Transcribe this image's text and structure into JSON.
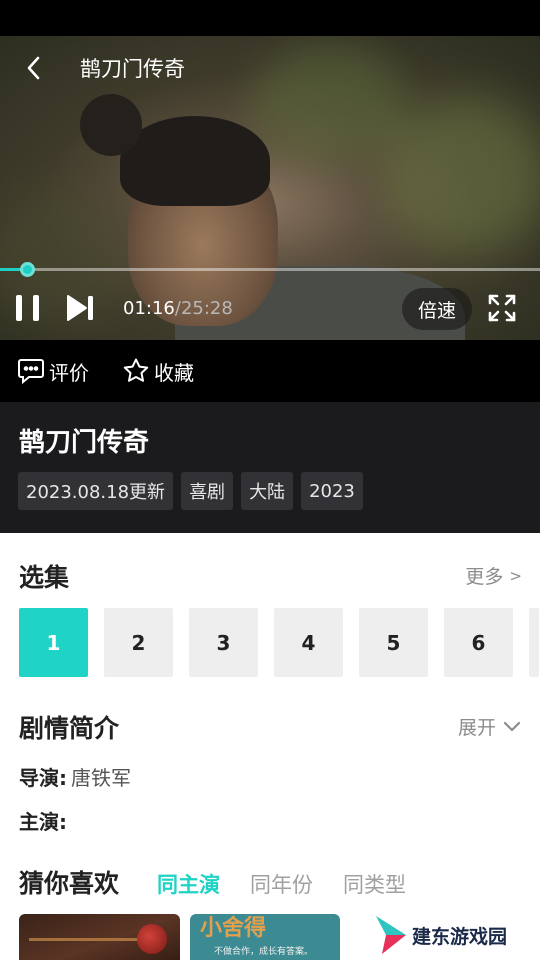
{
  "player": {
    "title": "鹊刀门传奇",
    "current_time": "01:16",
    "separator": "/",
    "total_time": "25:28",
    "progress": 0.05,
    "speed_label": "倍速",
    "accent": "#1fcfc3"
  },
  "actions": {
    "review_label": "评价",
    "favorite_label": "收藏"
  },
  "show": {
    "title": "鹊刀门传奇",
    "tags": [
      "2023.08.18更新",
      "喜剧",
      "大陆",
      "2023"
    ]
  },
  "episodes": {
    "title": "选集",
    "more_label": "更多",
    "more_arrow": ">",
    "items": [
      "1",
      "2",
      "3",
      "4",
      "5",
      "6"
    ],
    "selected": "1"
  },
  "synopsis": {
    "title": "剧情简介",
    "expand_label": "展开",
    "director_label": "导演:",
    "director": "唐铁军",
    "cast_label": "主演:",
    "cast": ""
  },
  "recommend": {
    "title": "猜你喜欢",
    "tabs": [
      "同主演",
      "同年份",
      "同类型"
    ],
    "active_tab": "同主演",
    "card2_title": "小舍得",
    "card2_caption": "不做合作，成长有答案。"
  },
  "watermark": {
    "text": "建东游戏园"
  },
  "icons": [
    "back-icon",
    "pause-icon",
    "next-icon",
    "fullscreen-icon",
    "comment-icon",
    "star-icon",
    "chevron-down-icon"
  ]
}
